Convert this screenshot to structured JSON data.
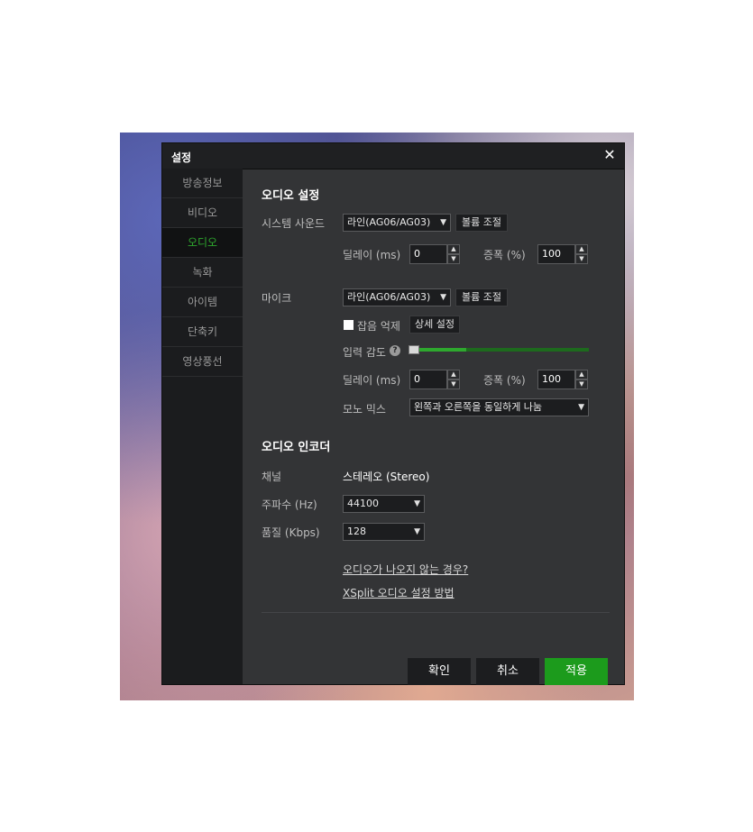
{
  "dialog": {
    "title": "설정"
  },
  "sidebar": {
    "items": [
      {
        "label": "방송정보"
      },
      {
        "label": "비디오"
      },
      {
        "label": "오디오",
        "active": true
      },
      {
        "label": "녹화"
      },
      {
        "label": "아이템"
      },
      {
        "label": "단축키"
      },
      {
        "label": "영상풍선"
      }
    ]
  },
  "audio_settings": {
    "heading": "오디오 설정",
    "system_sound": {
      "label": "시스템 사운드",
      "device": "라인(AG06/AG03)",
      "volume_button": "볼륨 조절",
      "delay_label": "딜레이 (ms)",
      "delay_value": "0",
      "gain_label": "증폭 (%)",
      "gain_value": "100"
    },
    "mic": {
      "label": "마이크",
      "device": "라인(AG06/AG03)",
      "volume_button": "볼륨 조절",
      "noise_suppression_label": "잡음 억제",
      "detail_button": "상세 설정",
      "sensitivity_label": "입력 감도",
      "sensitivity_help": "?",
      "sensitivity_level": 0.32,
      "delay_label": "딜레이 (ms)",
      "delay_value": "0",
      "gain_label": "증폭 (%)",
      "gain_value": "100",
      "mono_mix_label": "모노 믹스",
      "mono_mix_value": "왼쪽과 오른쪽을 동일하게 나눔"
    }
  },
  "audio_encoder": {
    "heading": "오디오 인코더",
    "channel_label": "채널",
    "channel_value": "스테레오 (Stereo)",
    "frequency_label": "주파수 (Hz)",
    "frequency_value": "44100",
    "quality_label": "품질 (Kbps)",
    "quality_value": "128"
  },
  "links": {
    "no_audio": "오디오가 나오지 않는 경우?",
    "xsplit": "XSplit 오디오 설정 방법"
  },
  "footer": {
    "ok": "확인",
    "cancel": "취소",
    "apply": "적용"
  },
  "colors": {
    "accent": "#1c9b1c",
    "active_nav": "#2ea82e",
    "dialog_bg": "#333436",
    "sidebar_bg": "#1b1c1e"
  }
}
